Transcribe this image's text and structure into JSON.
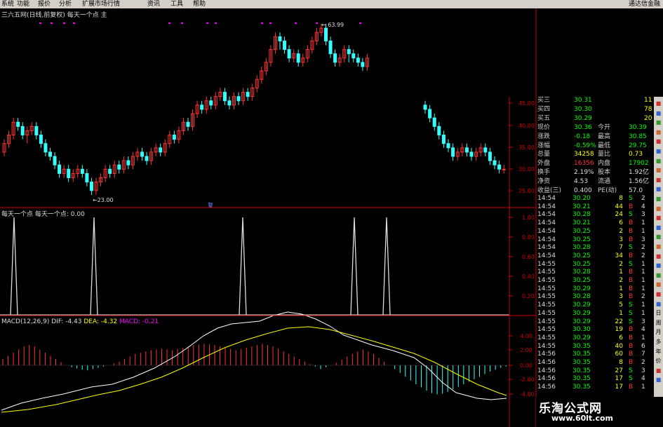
{
  "menu": {
    "items": [
      "系统",
      "功能",
      "报价",
      "分析",
      "扩展市场行情",
      "资讯",
      "工具",
      "帮助"
    ],
    "brand": "通达信金融"
  },
  "main_header": "三六五网(日线,前复权) 每天一个点 主",
  "sub_header": "每天一个点 每天一个点: 0.00",
  "macd_header": {
    "title": "MACD(12,26,9)",
    "dif": "DIF: -4.43",
    "dea": "DEA: -4.32",
    "macd": "MACD: -0.21"
  },
  "colors": {
    "up": "#ff3333",
    "down": "#33ffff",
    "dif": "#ffffff",
    "dea": "#ffff00",
    "macd_label": "#ff00ff",
    "axis": "#cc0000",
    "green": "#00ff00"
  },
  "chart_data": [
    {
      "type": "candlestick",
      "price_labels": [
        "45.00",
        "40.00",
        "35.00",
        "30.00",
        "25.00"
      ],
      "high_label": "63.99",
      "low_label": "23.00",
      "marker": "复",
      "candles_left": [
        [
          34,
          36,
          33,
          37
        ],
        [
          36,
          38,
          35,
          39
        ],
        [
          38,
          41,
          37,
          42
        ],
        [
          41,
          40,
          39,
          42
        ],
        [
          40,
          38,
          37,
          41
        ],
        [
          38,
          39,
          36,
          40
        ],
        [
          39,
          40,
          38,
          41
        ],
        [
          40,
          38,
          37,
          41
        ],
        [
          38,
          36,
          35,
          39
        ],
        [
          36,
          34,
          33,
          37
        ],
        [
          34,
          33,
          32,
          35
        ],
        [
          33,
          31,
          30,
          34
        ],
        [
          31,
          29,
          28,
          32
        ],
        [
          29,
          30,
          28,
          31
        ],
        [
          30,
          28,
          27,
          31
        ],
        [
          28,
          29,
          27,
          30
        ],
        [
          29,
          30,
          28,
          31
        ],
        [
          30,
          29,
          28,
          31
        ],
        [
          29,
          27,
          26,
          30
        ],
        [
          27,
          25,
          24,
          28
        ],
        [
          25,
          27,
          24,
          28
        ],
        [
          27,
          28,
          26,
          29
        ],
        [
          28,
          30,
          27,
          31
        ],
        [
          30,
          29,
          28,
          31
        ],
        [
          29,
          31,
          28,
          32
        ],
        [
          31,
          30,
          29,
          32
        ],
        [
          30,
          32,
          29,
          33
        ],
        [
          32,
          31,
          30,
          33
        ],
        [
          31,
          33,
          30,
          34
        ],
        [
          33,
          34,
          32,
          35
        ],
        [
          34,
          33,
          32,
          35
        ],
        [
          33,
          32,
          31,
          34
        ],
        [
          32,
          34,
          31,
          35
        ],
        [
          34,
          35,
          33,
          36
        ],
        [
          35,
          34,
          33,
          36
        ],
        [
          34,
          36,
          33,
          37
        ],
        [
          36,
          38,
          35,
          39
        ],
        [
          38,
          37,
          36,
          39
        ],
        [
          37,
          39,
          36,
          40
        ],
        [
          39,
          41,
          38,
          42
        ],
        [
          41,
          40,
          39,
          42
        ],
        [
          40,
          43,
          39,
          44
        ],
        [
          43,
          45,
          42,
          46
        ],
        [
          45,
          44,
          43,
          46
        ],
        [
          44,
          46,
          43,
          47
        ],
        [
          46,
          45,
          44,
          47
        ],
        [
          45,
          47,
          44,
          48
        ],
        [
          47,
          48,
          46,
          49
        ],
        [
          48,
          46,
          45,
          49
        ],
        [
          46,
          45,
          44,
          47
        ],
        [
          45,
          47,
          44,
          48
        ],
        [
          47,
          46,
          45,
          48
        ],
        [
          46,
          48,
          45,
          49
        ],
        [
          48,
          47,
          46,
          49
        ],
        [
          47,
          49,
          46,
          50
        ],
        [
          49,
          51,
          48,
          52
        ],
        [
          51,
          53,
          50,
          54
        ],
        [
          53,
          55,
          52,
          56
        ],
        [
          55,
          58,
          54,
          59
        ],
        [
          58,
          61,
          57,
          62
        ],
        [
          61,
          60,
          58,
          62
        ],
        [
          60,
          58,
          57,
          61
        ],
        [
          58,
          56,
          55,
          59
        ],
        [
          56,
          57,
          55,
          58
        ],
        [
          57,
          55,
          54,
          58
        ],
        [
          55,
          56,
          54,
          57
        ],
        [
          56,
          58,
          55,
          59
        ],
        [
          58,
          60,
          57,
          61
        ],
        [
          60,
          62,
          59,
          63
        ],
        [
          62,
          63,
          61,
          64
        ],
        [
          63,
          60,
          59,
          64
        ],
        [
          60,
          57,
          56,
          61
        ],
        [
          57,
          55,
          54,
          58
        ],
        [
          55,
          56,
          54,
          57
        ],
        [
          56,
          58,
          55,
          59
        ],
        [
          58,
          57,
          55,
          59
        ],
        [
          57,
          56,
          55,
          58
        ],
        [
          56,
          55,
          54,
          57
        ],
        [
          55,
          54,
          53,
          56
        ],
        [
          54,
          56,
          53,
          57
        ]
      ],
      "candles_right": [
        [
          45,
          44,
          43,
          46
        ],
        [
          44,
          42,
          41,
          45
        ],
        [
          42,
          40,
          39,
          43
        ],
        [
          40,
          38,
          37,
          41
        ],
        [
          38,
          36,
          35,
          39
        ],
        [
          36,
          35,
          34,
          37
        ],
        [
          35,
          33,
          32,
          36
        ],
        [
          33,
          34,
          32,
          35
        ],
        [
          34,
          35,
          33,
          36
        ],
        [
          35,
          34,
          33,
          36
        ],
        [
          34,
          33,
          32,
          35
        ],
        [
          33,
          34,
          32,
          35
        ],
        [
          34,
          35,
          33,
          36
        ],
        [
          35,
          34,
          33,
          36
        ],
        [
          34,
          32,
          31,
          35
        ],
        [
          32,
          31,
          30,
          33
        ],
        [
          31,
          30,
          29,
          32
        ],
        [
          30,
          30,
          29,
          31
        ]
      ]
    },
    {
      "type": "line",
      "title": "每天一个点",
      "ylim": [
        0,
        1
      ],
      "y_ticks": [
        "1.00",
        "0.80",
        "0.60",
        "0.40",
        "0.20"
      ],
      "spike_x": [
        20,
        134,
        346,
        505,
        551
      ],
      "spike_x_right": []
    },
    {
      "type": "line",
      "title": "MACD(12,26,9)",
      "y_ticks": [
        "4.00",
        "2.00",
        "0.00",
        "-2.00",
        "-4.00"
      ],
      "hist_left": [
        1,
        1.5,
        2,
        2.5,
        3,
        3.2,
        3,
        2.5,
        2,
        1.5,
        1,
        0.5,
        0,
        -0.3,
        -0.5,
        -0.7,
        -0.8,
        -0.6,
        -0.4,
        -0.2,
        0,
        0.3,
        0.6,
        1,
        1.4,
        1.8,
        2,
        2.2,
        2.4,
        2.5,
        2.6,
        2.5,
        2.4,
        2.6,
        2.8,
        3,
        3.2,
        3.3,
        3.4,
        3.3,
        3.2,
        3,
        2.8,
        2.6,
        2.4,
        2.6,
        2.8,
        3,
        3.2,
        3.4,
        3.2,
        3,
        2.6,
        2.2,
        1.8,
        1.4,
        1,
        0.6,
        0.2,
        -0.2,
        -0.6,
        -0.3,
        0,
        0.4,
        0.9,
        1.4,
        1.8,
        2.2,
        2.5,
        2.2,
        1.8,
        1.2,
        0.6,
        0,
        -0.6,
        -1.2,
        -1.8,
        -2.4,
        -3,
        -3.5,
        -4,
        -4.4,
        -4.6,
        -4.5,
        -4.2,
        -3.8,
        -3.4,
        -3,
        -2.6,
        -2.2,
        -1.8,
        -1.4,
        -1,
        -0.7,
        -0.4,
        -0.2
      ],
      "dif_points": [
        [
          2,
          585
        ],
        [
          30,
          575
        ],
        [
          60,
          568
        ],
        [
          90,
          562
        ],
        [
          110,
          557
        ],
        [
          130,
          552
        ],
        [
          160,
          548
        ],
        [
          190,
          538
        ],
        [
          220,
          525
        ],
        [
          250,
          508
        ],
        [
          270,
          494
        ],
        [
          290,
          479
        ],
        [
          310,
          468
        ],
        [
          330,
          462
        ],
        [
          350,
          460
        ],
        [
          370,
          458
        ],
        [
          390,
          450
        ],
        [
          410,
          445
        ],
        [
          430,
          448
        ],
        [
          450,
          455
        ],
        [
          470,
          465
        ],
        [
          490,
          478
        ],
        [
          510,
          485
        ],
        [
          530,
          492
        ],
        [
          560,
          500
        ],
        [
          590,
          510
        ],
        [
          610,
          525
        ],
        [
          630,
          545
        ],
        [
          650,
          560
        ],
        [
          680,
          568
        ],
        [
          700,
          570
        ],
        [
          722,
          568
        ]
      ],
      "dea_points": [
        [
          2,
          588
        ],
        [
          40,
          584
        ],
        [
          80,
          577
        ],
        [
          110,
          570
        ],
        [
          140,
          563
        ],
        [
          170,
          557
        ],
        [
          200,
          548
        ],
        [
          230,
          538
        ],
        [
          260,
          525
        ],
        [
          290,
          510
        ],
        [
          320,
          496
        ],
        [
          350,
          485
        ],
        [
          380,
          476
        ],
        [
          410,
          468
        ],
        [
          440,
          466
        ],
        [
          470,
          470
        ],
        [
          500,
          478
        ],
        [
          530,
          486
        ],
        [
          560,
          495
        ],
        [
          590,
          504
        ],
        [
          620,
          517
        ],
        [
          650,
          533
        ],
        [
          680,
          548
        ],
        [
          710,
          560
        ],
        [
          722,
          564
        ]
      ]
    }
  ],
  "quote": [
    {
      "label": "买三",
      "value": "30.31",
      "vol": "11"
    },
    {
      "label": "买四",
      "value": "30.30",
      "vol": "78"
    },
    {
      "label": "买五",
      "value": "30.29",
      "vol": "20"
    },
    {
      "label": "现价",
      "value": "30.36",
      "label2": "今开",
      "value2": "30.39"
    },
    {
      "label": "涨跌",
      "value": "-0.18",
      "label2": "最高",
      "value2": "30.85"
    },
    {
      "label": "涨幅",
      "value": "-0.59%",
      "label2": "最低",
      "value2": "29.75"
    },
    {
      "label": "总量",
      "value": "34258",
      "label2": "量比",
      "value2": "0.73"
    },
    {
      "label": "外盘",
      "value": "16356",
      "label2": "内盘",
      "value2": "17902"
    },
    {
      "label": "换手",
      "value": "2.19%",
      "label2": "股本",
      "value2": "1.92亿"
    },
    {
      "label": "净资",
      "value": "4.53",
      "label2": "流通",
      "value2": "1.56亿"
    },
    {
      "label": "收益(三)",
      "value": "0.400",
      "label2": "PE(动)",
      "value2": "57.0"
    }
  ],
  "ticks": [
    [
      "14:54",
      "30.20",
      "8",
      "S",
      "2"
    ],
    [
      "14:54",
      "30.21",
      "44",
      "B",
      "4"
    ],
    [
      "14:54",
      "30.28",
      "24",
      "S",
      "3"
    ],
    [
      "14:54",
      "30.21",
      "6",
      "B",
      "1"
    ],
    [
      "14:54",
      "30.25",
      "2",
      "B",
      "1"
    ],
    [
      "14:54",
      "30.25",
      "3",
      "B",
      "3"
    ],
    [
      "14:54",
      "30.28",
      "7",
      "S",
      "2"
    ],
    [
      "14:54",
      "30.25",
      "34",
      "B",
      "2"
    ],
    [
      "14:55",
      "30.25",
      "2",
      "S",
      "1"
    ],
    [
      "14:55",
      "30.28",
      "1",
      "B",
      "1"
    ],
    [
      "14:55",
      "30.25",
      "2",
      "B",
      "1"
    ],
    [
      "14:55",
      "30.29",
      "1",
      "B",
      "1"
    ],
    [
      "14:55",
      "30.28",
      "3",
      "B",
      "2"
    ],
    [
      "14:55",
      "30.29",
      "5",
      "S",
      "1"
    ],
    [
      "14:55",
      "30.29",
      "1",
      "S",
      "1"
    ],
    [
      "14:55",
      "30.29",
      "22",
      "S",
      "3"
    ],
    [
      "14:55",
      "30.30",
      "19",
      "B",
      "4"
    ],
    [
      "14:55",
      "30.29",
      "6",
      "B",
      "1"
    ],
    [
      "14:55",
      "30.35",
      "40",
      "B",
      "6"
    ],
    [
      "14:56",
      "30.35",
      "60",
      "B",
      "7"
    ],
    [
      "14:56",
      "30.35",
      "8",
      "B",
      "2"
    ],
    [
      "14:56",
      "30.35",
      "27",
      "S",
      "3"
    ],
    [
      "14:56",
      "30.35",
      "17",
      "S",
      "4"
    ],
    [
      "14:56",
      "30.35",
      "17",
      "B",
      "1"
    ]
  ],
  "toolbar_icons": [
    "■",
    "■",
    "■",
    "■",
    "■",
    "■",
    "■",
    "■",
    "■",
    "■",
    "■",
    "■",
    "■",
    "■",
    "■",
    "■",
    "■",
    "■",
    "■",
    "■",
    "■",
    "■",
    "日",
    "周",
    "月",
    "多",
    "年",
    "价",
    "■",
    "■"
  ],
  "watermark": {
    "line1": "乐淘公式网",
    "line2": "www.60lt.com"
  }
}
